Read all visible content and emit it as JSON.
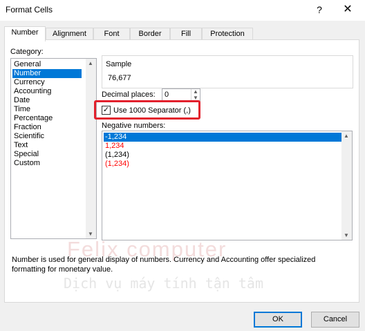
{
  "window": {
    "title": "Format Cells",
    "help": "?",
    "close": "✕"
  },
  "tabs": [
    {
      "label": "Number"
    },
    {
      "label": "Alignment"
    },
    {
      "label": "Font"
    },
    {
      "label": "Border"
    },
    {
      "label": "Fill"
    },
    {
      "label": "Protection"
    }
  ],
  "category": {
    "label": "Category:",
    "items": [
      "General",
      "Number",
      "Currency",
      "Accounting",
      "Date",
      "Time",
      "Percentage",
      "Fraction",
      "Scientific",
      "Text",
      "Special",
      "Custom"
    ],
    "selected": "Number"
  },
  "sample": {
    "label": "Sample",
    "value": "76,677"
  },
  "decimal": {
    "label": "Decimal places:",
    "value": "0"
  },
  "separator": {
    "label": "Use 1000 Separator (,)",
    "checked": true
  },
  "negative": {
    "label": "Negative numbers:",
    "items": [
      {
        "text": "-1,234",
        "color": "#000000"
      },
      {
        "text": "1,234",
        "color": "#ff0000"
      },
      {
        "text": "(1,234)",
        "color": "#000000"
      },
      {
        "text": "(1,234)",
        "color": "#ff0000"
      }
    ],
    "selected": 0
  },
  "description": "Number is used for general display of numbers.  Currency and Accounting offer specialized formatting for monetary value.",
  "watermark": {
    "line1": "Felix computer",
    "line2": "Dịch vụ máy tính tận tâm"
  },
  "buttons": {
    "ok": "OK",
    "cancel": "Cancel"
  },
  "colors": {
    "accent": "#0078d7",
    "highlight": "#e2202c"
  }
}
